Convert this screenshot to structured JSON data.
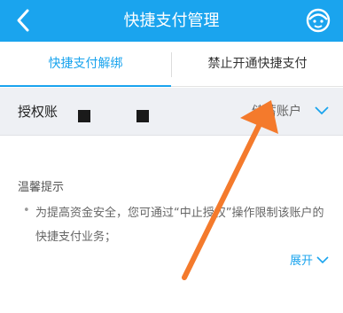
{
  "header": {
    "title": "快捷支付管理",
    "colors": {
      "bar": "#1aa4ee",
      "text": "#ffffff"
    }
  },
  "tabs": [
    {
      "label": "快捷支付解绑",
      "active": true
    },
    {
      "label": "禁止开通快捷支付",
      "active": false
    }
  ],
  "account": {
    "label": "授权账",
    "type": "储蓄账户"
  },
  "tips": {
    "title": "温馨提示",
    "text": "为提高资金安全，您可通过“中止授权”操作限制该账户的快捷支付业务；",
    "expand_label": "展开"
  },
  "annotation_arrow": {
    "color": "#f47a2c"
  }
}
